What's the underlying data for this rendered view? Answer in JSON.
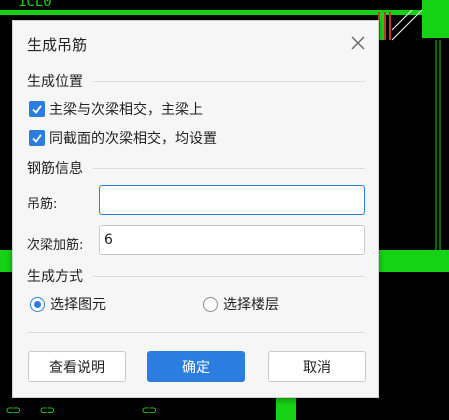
{
  "background": {
    "label_top": "1CL0"
  },
  "dialog": {
    "title": "生成吊筋",
    "close_icon": "close-icon",
    "position_section": {
      "label": "生成位置",
      "options": [
        {
          "label": "主梁与次梁相交，主梁上",
          "checked": true
        },
        {
          "label": "同截面的次梁相交，均设置",
          "checked": true
        }
      ]
    },
    "rebar_section": {
      "label": "钢筋信息",
      "hanger": {
        "label": "吊筋:",
        "value": "",
        "focused": true
      },
      "secondary": {
        "label": "次梁加筋:",
        "value": "6"
      }
    },
    "method_section": {
      "label": "生成方式",
      "options": [
        {
          "label": "选择图元",
          "selected": true
        },
        {
          "label": "选择楼层",
          "selected": false
        }
      ]
    },
    "buttons": {
      "help": "查看说明",
      "ok": "确定",
      "cancel": "取消"
    }
  },
  "colors": {
    "cad_green": "#16d214",
    "accent": "#2b7de0",
    "dialog_bg": "#f6f6f6"
  }
}
